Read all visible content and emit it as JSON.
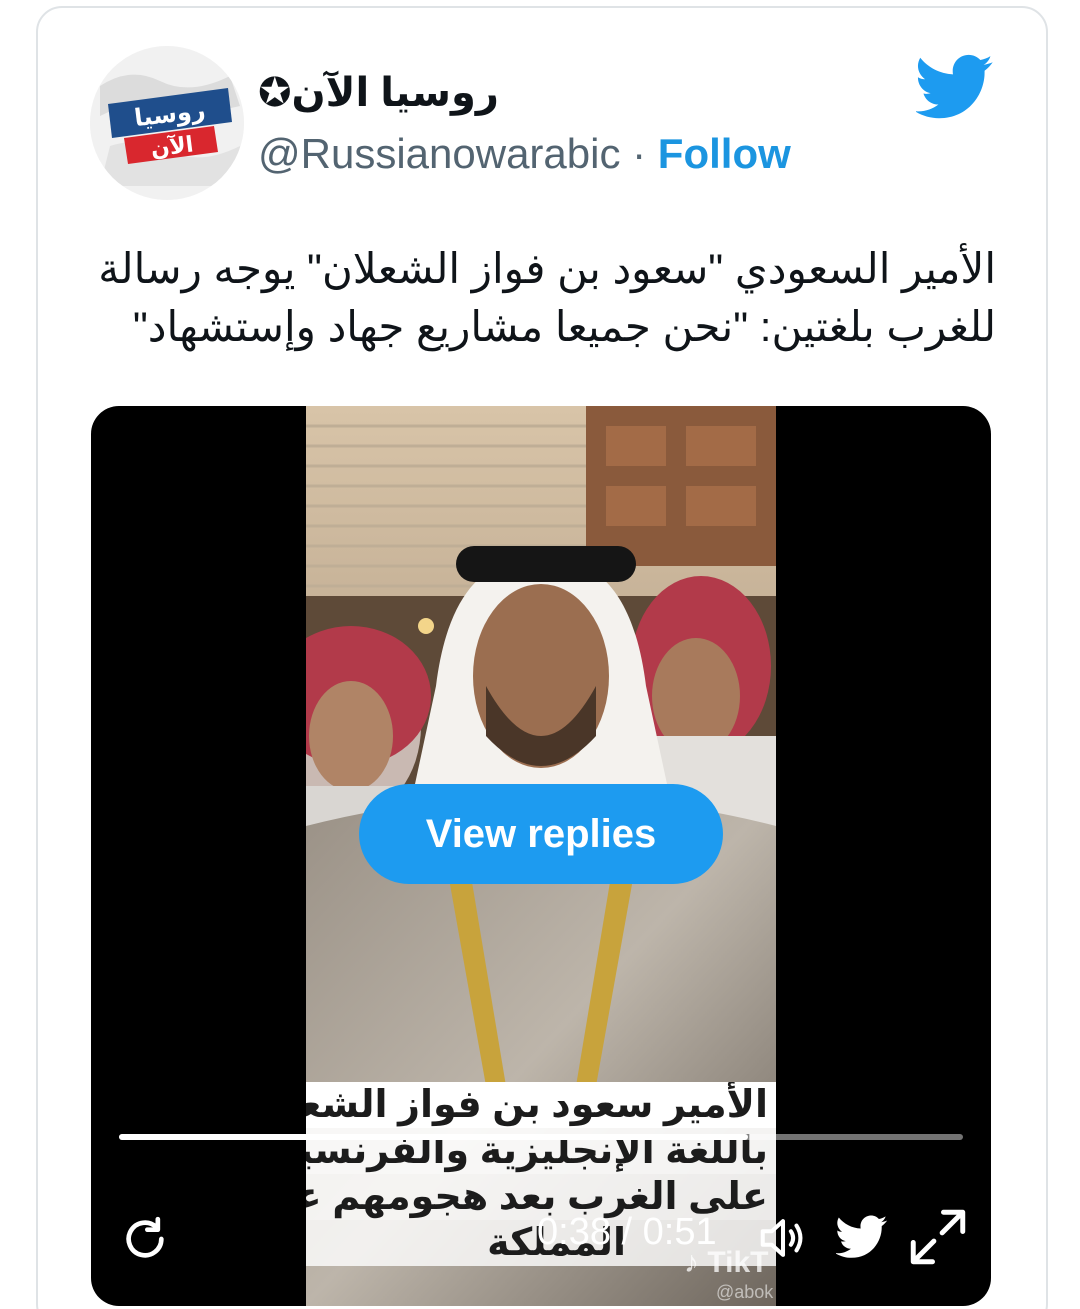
{
  "account": {
    "display_name": "روسيا الآن✪",
    "handle": "@Russianowarabic",
    "separator": " · ",
    "follow_label": "Follow",
    "avatar_text_top": "روسيا",
    "avatar_text_bottom": "الآن"
  },
  "tweet": {
    "text_line1": "الأمير السعودي \"سعود بن فواز الشعلان\" يوجه رسالة",
    "text_line2": "للغرب بلغتين: \"نحن جميعا مشاريع جهاد وإستشهاد\""
  },
  "media": {
    "view_replies_label": "View replies",
    "overlay_caption": [
      "الأمير سعود بن فواز الشعلان",
      "باللغة الإنجليزية والفرنسية",
      "على الغرب بعد هجومهم على",
      "المملكة"
    ],
    "watermark": "TikT",
    "watermark_handle": "@abok",
    "time_display": "0:38 / 0:51",
    "progress_fraction": 0.745
  },
  "colors": {
    "twitter_blue": "#1d9bf0",
    "follow_blue": "#1b95e0",
    "text_primary": "#0f1419",
    "text_secondary": "#536471"
  },
  "icons": [
    "twitter-bird-icon",
    "replay-icon",
    "volume-icon",
    "twitter-small-icon",
    "expand-icon"
  ]
}
